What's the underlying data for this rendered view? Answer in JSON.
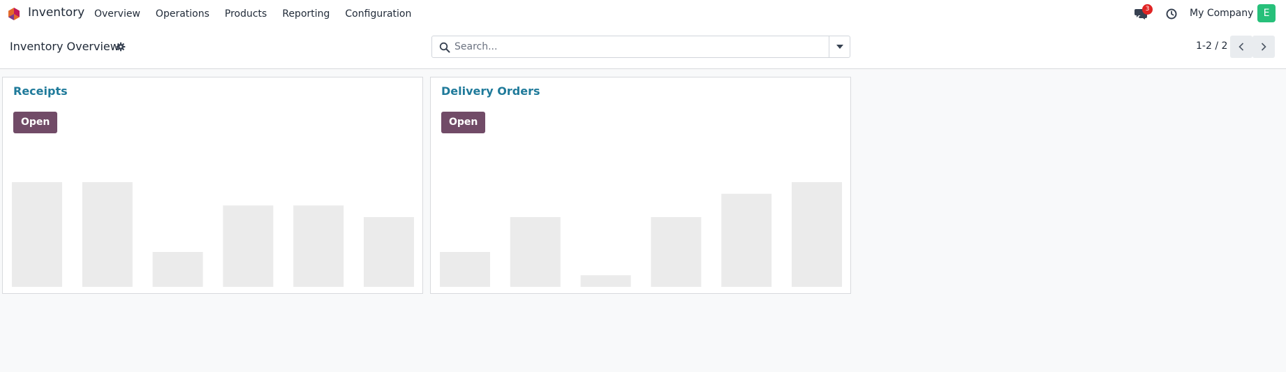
{
  "navbar": {
    "app_name": "Inventory",
    "menu": [
      "Overview",
      "Operations",
      "Products",
      "Reporting",
      "Configuration"
    ],
    "chat_badge": "3",
    "company": "My Company",
    "avatar_letter": "E",
    "icons": [
      "app-logo-icon",
      "chat-icon",
      "clock-icon"
    ]
  },
  "control_panel": {
    "title": "Inventory Overview",
    "search": {
      "placeholder": "Search...",
      "value": ""
    },
    "pager": {
      "value": "1-2 / 2"
    }
  },
  "colors": {
    "accent": "#714b67",
    "title_link": "#1f7a9a",
    "badge": "#e02424",
    "avatar": "#27c07a",
    "bar": "#ebebeb"
  },
  "cards": [
    {
      "title": "Receipts",
      "button": "Open"
    },
    {
      "title": "Delivery Orders",
      "button": "Open"
    }
  ],
  "chart_data": [
    {
      "type": "bar",
      "title": "",
      "categories": [],
      "values": [
        9,
        9,
        3,
        7,
        7,
        6
      ],
      "ylim": [
        0,
        9
      ],
      "grid": false
    },
    {
      "type": "bar",
      "title": "",
      "categories": [],
      "values": [
        3,
        6,
        1,
        6,
        8,
        9
      ],
      "ylim": [
        0,
        9
      ],
      "grid": false
    }
  ]
}
